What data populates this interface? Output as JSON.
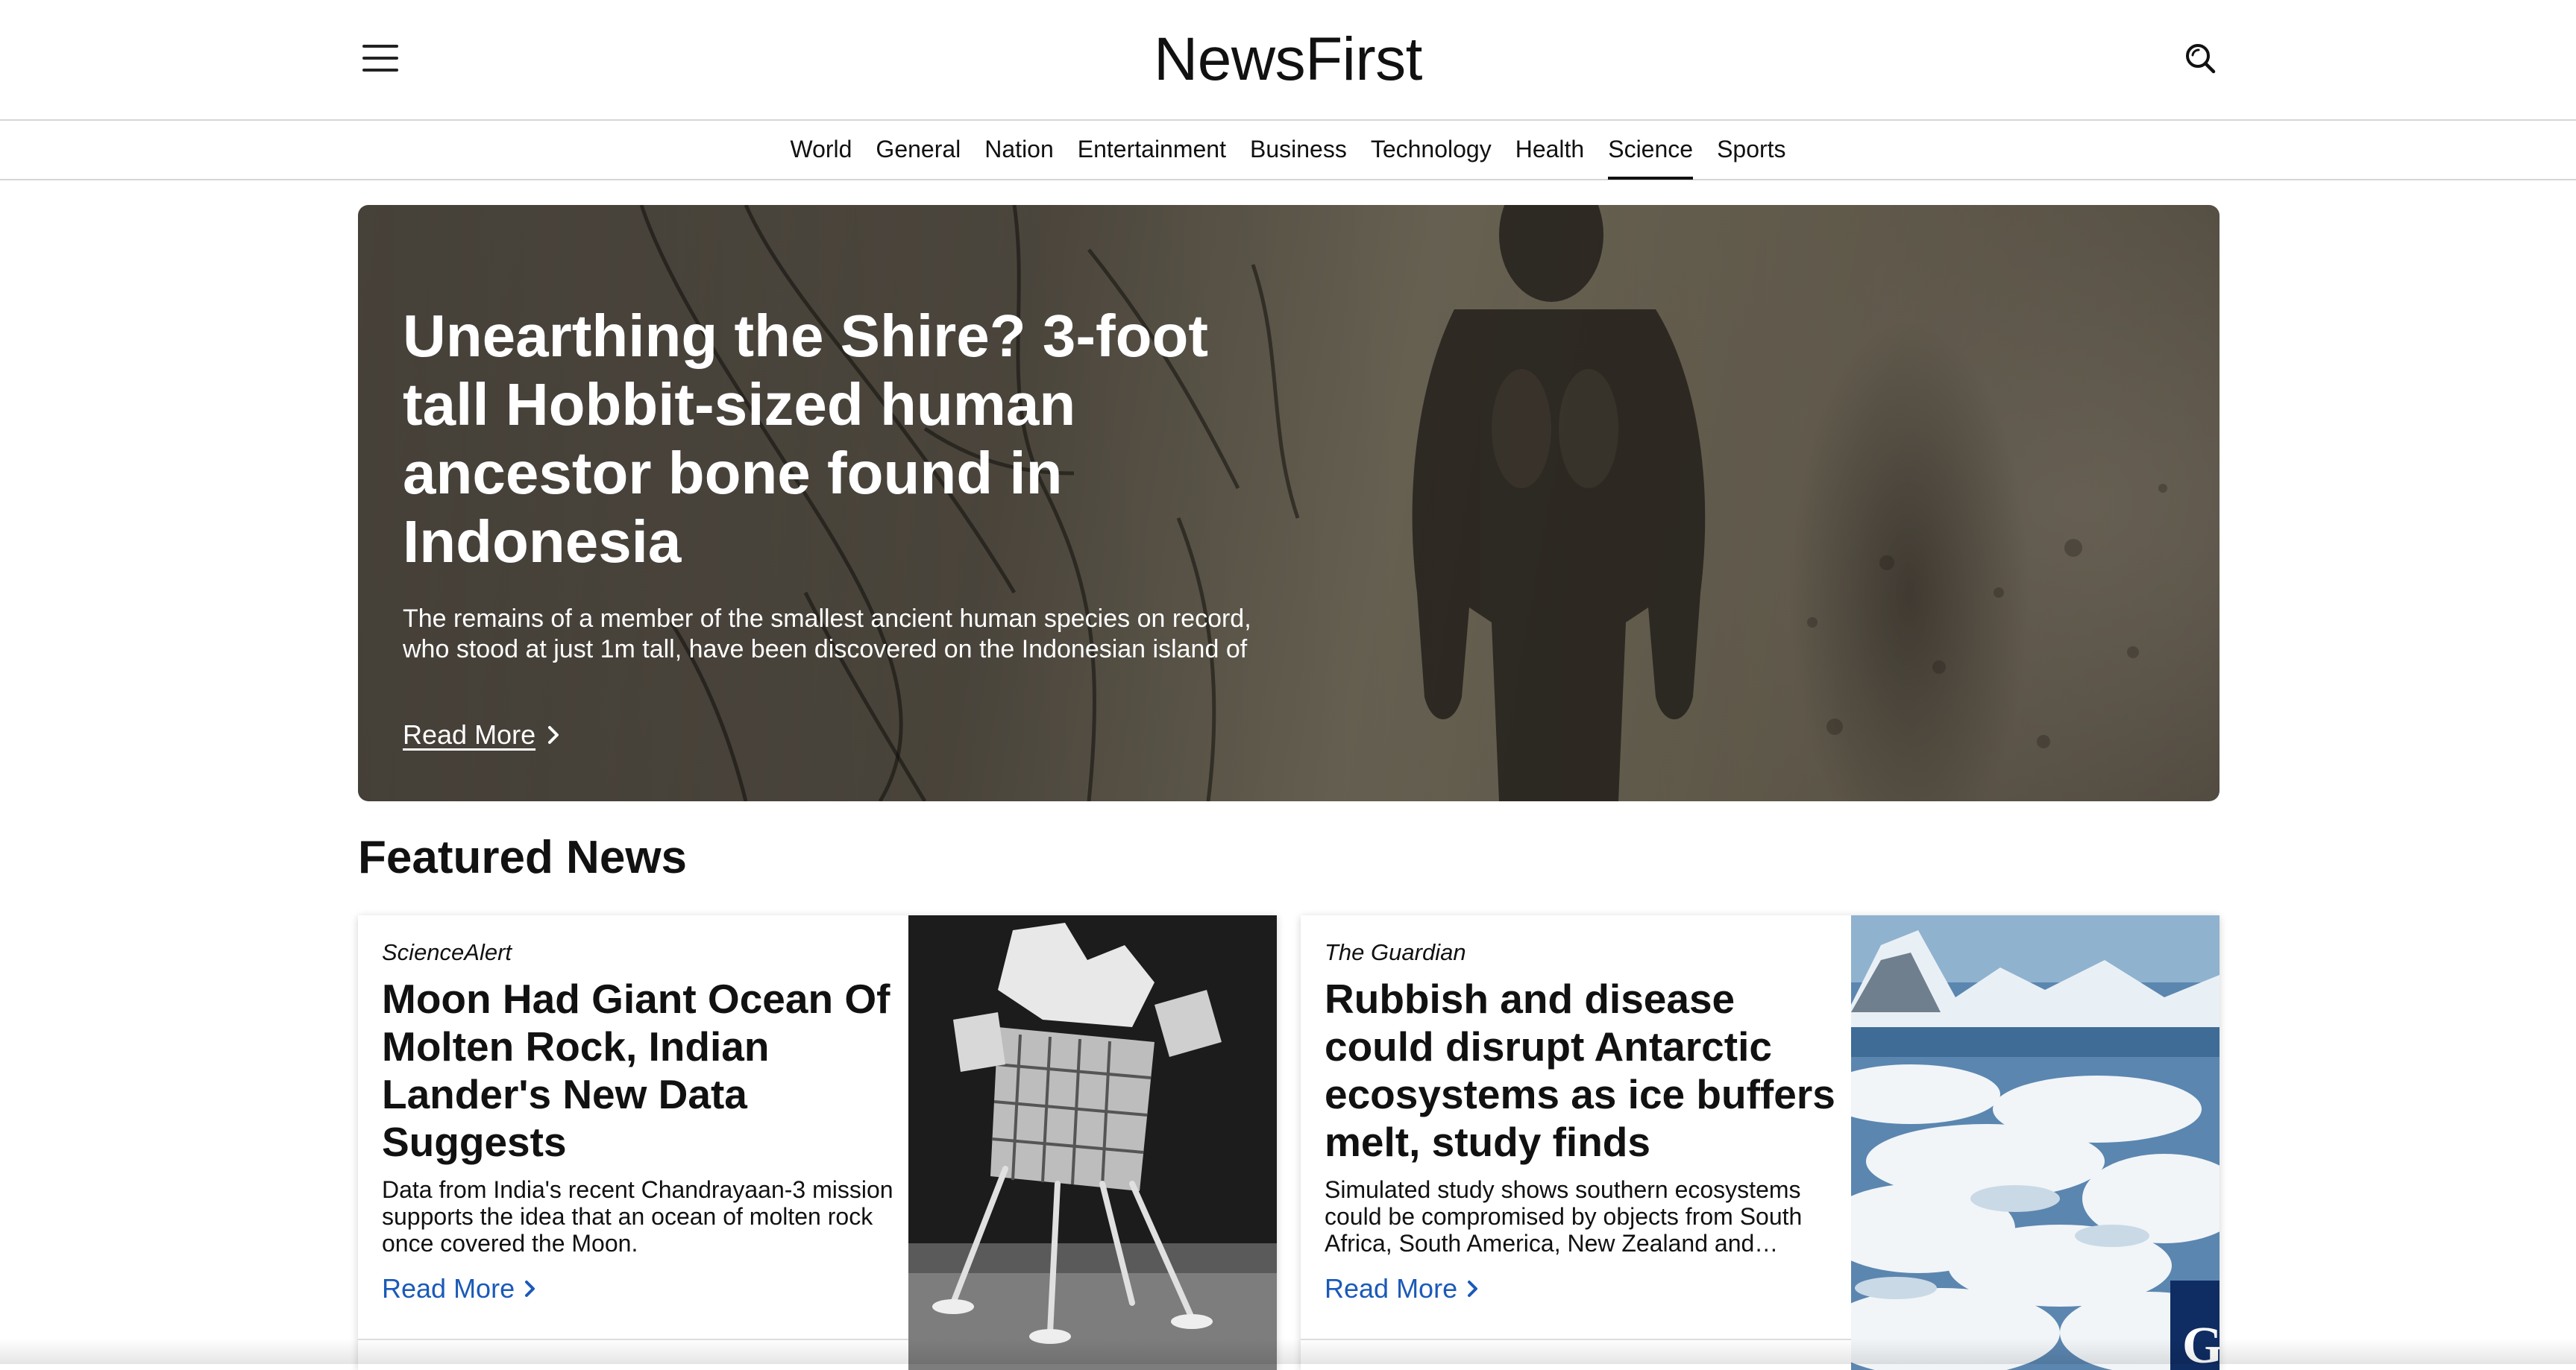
{
  "header": {
    "logo": "NewsFirst",
    "menu_icon": "hamburger-menu-icon",
    "search_icon": "search-icon"
  },
  "nav": {
    "items": [
      {
        "label": "World"
      },
      {
        "label": "General"
      },
      {
        "label": "Nation"
      },
      {
        "label": "Entertainment"
      },
      {
        "label": "Business"
      },
      {
        "label": "Technology"
      },
      {
        "label": "Health"
      },
      {
        "label": "Science"
      },
      {
        "label": "Sports"
      }
    ],
    "active": "Science"
  },
  "hero": {
    "title": "Unearthing the Shire? 3-foot tall Hobbit-sized human ancestor bone found in Indonesia",
    "summary": "The remains of a member of the smallest ancient human species on record, who stood at just 1m tall, have been discovered on the Indonesian island of",
    "read_more": "Read More"
  },
  "featured": {
    "heading": "Featured News",
    "cards": [
      {
        "source": "ScienceAlert",
        "title": "Moon Had Giant Ocean Of Molten Rock, Indian Lander's New Data Suggests",
        "summary": "Data from India's recent Chandrayaan-3 mission supports the idea that an ocean of molten rock once covered the Moon.",
        "read_more": "Read More"
      },
      {
        "source": "The Guardian",
        "title": "Rubbish and disease could disrupt Antarctic ecosystems as ice buffers melt, study finds",
        "summary": "Simulated study shows southern ecosystems could be compromised by objects from South Africa, South America, New Zealand and…",
        "read_more": "Read More"
      }
    ]
  },
  "colors": {
    "link_blue": "#1b5ab8",
    "text": "#111111",
    "border": "#d6d6d6"
  }
}
